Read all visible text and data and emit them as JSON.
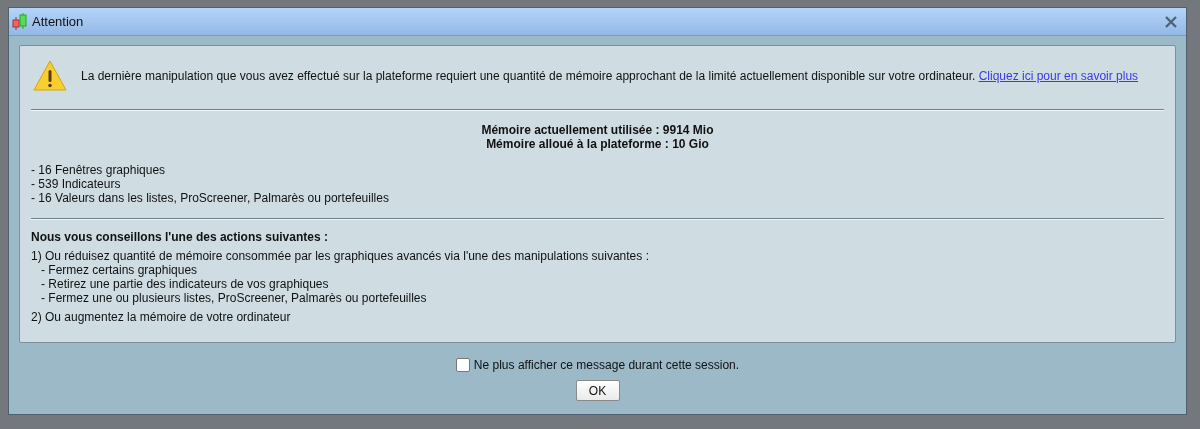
{
  "window": {
    "title": "Attention"
  },
  "message": {
    "text": "La dernière manipulation que vous avez effectué sur la plateforme requiert une quantité de mémoire approchant de la limité actuellement disponible sur votre ordinateur.",
    "link": "Cliquez ici pour en savoir plus"
  },
  "memory": [
    "Mémoire actuellement utilisée : 9914 Mio",
    "Mémoire alloué à la plateforme : 10 Gio"
  ],
  "stats": [
    "- 16 Fenêtres graphiques",
    "- 539 Indicateurs",
    "- 16 Valeurs dans les listes, ProScreener, Palmarès ou portefeuilles"
  ],
  "advice": {
    "heading": "Nous vous conseillons l'une des actions suivantes :",
    "actions": [
      {
        "text": "1) Ou réduisez quantité de mémoire consommée par les graphiques avancés via l'une des manipulations suivantes :",
        "children": [
          "- Fermez certains graphiques",
          "- Retirez une partie des indicateurs de vos graphiques",
          "- Fermez une ou plusieurs listes, ProScreener, Palmarès ou portefeuilles"
        ]
      },
      {
        "text": "2) Ou augmentez la mémoire de votre ordinateur"
      }
    ]
  },
  "dont_show": {
    "label": "Ne plus afficher ce message durant cette session.",
    "checked": false
  },
  "buttons": [
    "OK"
  ]
}
